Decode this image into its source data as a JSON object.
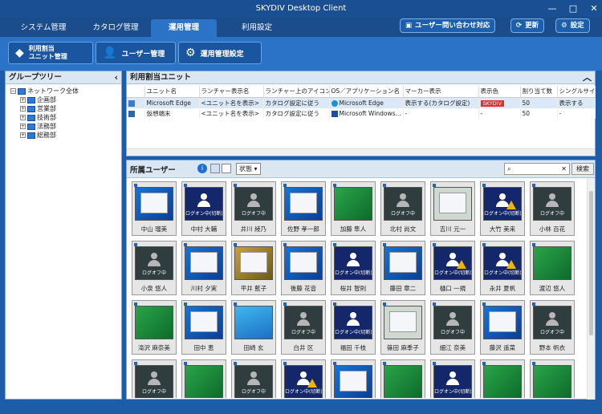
{
  "window": {
    "title": "SKYDIV Desktop Client"
  },
  "tabs": [
    {
      "label": "システム管理"
    },
    {
      "label": "カタログ管理"
    },
    {
      "label": "運用管理"
    },
    {
      "label": "利用設定"
    }
  ],
  "top_buttons": {
    "contact": "ユーザー問い合わせ対応",
    "refresh": "更新",
    "settings": "設定"
  },
  "sub_buttons": [
    {
      "label": "利用割当\nユニット管理"
    },
    {
      "label": "ユーザー管理"
    },
    {
      "label": "運用管理設定"
    }
  ],
  "group_panel": {
    "title": "グループツリー",
    "root": "ネットワーク全体",
    "groups": [
      "企画部",
      "営業部",
      "技術部",
      "法務部",
      "総務部"
    ]
  },
  "unit_panel": {
    "title": "利用割当ユニット",
    "columns": [
      "ユニット名",
      "ランチャー表示名",
      "ランチャー上のアイコン",
      "OS／アプリケーション名",
      "マーカー表示",
      "表示色",
      "割り当て数",
      "シングルサイン"
    ],
    "rows": [
      [
        "Microsoft Edge",
        "<ユニット名を表示>",
        "カタログ設定に従う",
        "Microsoft Edge",
        "表示する(カタログ設定)",
        "SKYDIV",
        "50",
        "表示する"
      ],
      [
        "仮想端末",
        "<ユニット名を表示>",
        "カタログ設定に従う",
        "Microsoft Windows...",
        "-",
        "-",
        "50",
        "-"
      ]
    ]
  },
  "user_panel": {
    "title": "所属ユーザー",
    "status_label": "状態",
    "search_button": "検索",
    "search_placeholder": "",
    "users": [
      {
        "name": "中山 瑠美",
        "state": "desk"
      },
      {
        "name": "中村 大輔",
        "state": "lock",
        "text": "ログオン中(切断)"
      },
      {
        "name": "井川 綾乃",
        "state": "off",
        "text": "ログオフ中"
      },
      {
        "name": "佐野 孝一郎",
        "state": "desk"
      },
      {
        "name": "加藤 隼人",
        "state": "green"
      },
      {
        "name": "北村 尚文",
        "state": "off",
        "text": "ログオフ中"
      },
      {
        "name": "吉川 元一",
        "state": "map"
      },
      {
        "name": "大竹 美来",
        "state": "lockwarn",
        "text": "ログオン中(切断)"
      },
      {
        "name": "小林 百花",
        "state": "off",
        "text": "ログオフ中"
      },
      {
        "name": "小泉 悠人",
        "state": "off",
        "text": "ログオフ中"
      },
      {
        "name": "川村 夕実",
        "state": "desk"
      },
      {
        "name": "平井 藍子",
        "state": "gold"
      },
      {
        "name": "後藤 花音",
        "state": "desk"
      },
      {
        "name": "桜井 智則",
        "state": "lock",
        "text": "ログオン中(切断)"
      },
      {
        "name": "藤田 章二",
        "state": "desk"
      },
      {
        "name": "樋口 一規",
        "state": "lockwarn",
        "text": "ログオン中(切断)"
      },
      {
        "name": "永井 夏帆",
        "state": "lockwarn",
        "text": "ログオン中(切断)"
      },
      {
        "name": "渡辺 悠人",
        "state": "green"
      },
      {
        "name": "滝沢 麻奈美",
        "state": "green"
      },
      {
        "name": "田中 恵",
        "state": "desk"
      },
      {
        "name": "田崎 玄",
        "state": "sea"
      },
      {
        "name": "白井 区",
        "state": "off",
        "text": "ログオフ中"
      },
      {
        "name": "福田 千枝",
        "state": "lock",
        "text": "ログオン中(切断)"
      },
      {
        "name": "篠田 麻季子",
        "state": "map"
      },
      {
        "name": "細江 奈美",
        "state": "off",
        "text": "ログオフ中"
      },
      {
        "name": "藤沢 遥菜",
        "state": "desk"
      },
      {
        "name": "野本 帆衣",
        "state": "off",
        "text": "ログオフ中"
      },
      {
        "name": "",
        "state": "off",
        "text": "ログオフ中"
      },
      {
        "name": "",
        "state": "green"
      },
      {
        "name": "",
        "state": "off",
        "text": "ログオフ中"
      },
      {
        "name": "",
        "state": "lockwarn",
        "text": "ログオン中(切断)"
      },
      {
        "name": "",
        "state": "desk"
      },
      {
        "name": "",
        "state": "green"
      },
      {
        "name": "",
        "state": "lock",
        "text": "ログオン中(切断)"
      },
      {
        "name": "",
        "state": "green"
      },
      {
        "name": "",
        "state": "green"
      }
    ]
  },
  "colors": {
    "app_blue": "#1d5da8",
    "active_tab": "#2b73c6",
    "marker_red": "#dd3333"
  }
}
